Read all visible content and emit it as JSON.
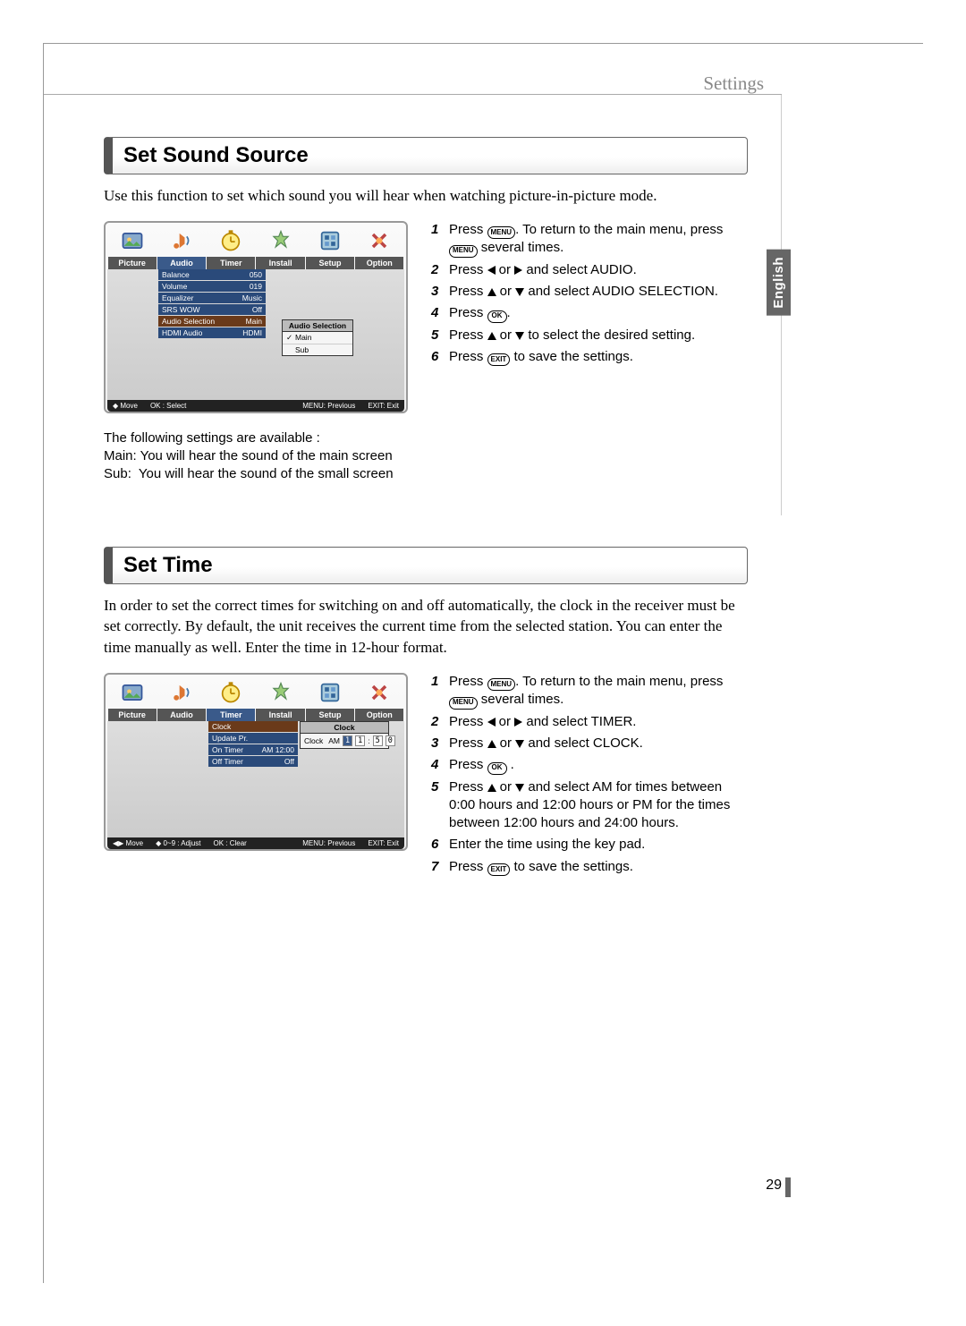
{
  "header": {
    "category": "Settings",
    "language": "English",
    "page_number": "29"
  },
  "tabs": [
    "Picture",
    "Audio",
    "Timer",
    "Install",
    "Setup",
    "Option"
  ],
  "section1": {
    "title": "Set Sound Source",
    "intro": "Use this function to set which sound you will hear when watching picture-in-picture mode.",
    "audio_menu": {
      "items": [
        {
          "label": "Balance",
          "value": "050"
        },
        {
          "label": "Volume",
          "value": "019"
        },
        {
          "label": "Equalizer",
          "value": "Music"
        },
        {
          "label": "SRS WOW",
          "value": "Off"
        },
        {
          "label": "Audio Selection",
          "value": "Main"
        },
        {
          "label": "HDMI Audio",
          "value": "HDMI"
        }
      ],
      "popup_title": "Audio Selection",
      "popup_options": [
        "Main",
        "Sub"
      ],
      "footer": {
        "move": "Move",
        "ok": "OK : Select",
        "menu": "MENU: Previous",
        "exit": "EXIT: Exit"
      }
    },
    "steps": {
      "s1a": "Press ",
      "s1b": ". To return to the main menu, press ",
      "s1c": " several times.",
      "s2a": "Press ",
      "s2b": " or ",
      "s2c": " and select AUDIO.",
      "s3a": "Press ",
      "s3b": " or ",
      "s3c": " and select AUDIO SELECTION.",
      "s4a": "Press ",
      "s4b": ".",
      "s5a": "Press ",
      "s5b": " or ",
      "s5c": " to select the desired setting.",
      "s6a": "Press ",
      "s6b": " to save the settings."
    },
    "available": {
      "heading": "The following settings are available :",
      "main": "Main: You will hear the sound of the main screen",
      "sub": "Sub:  You will hear the sound of the small screen"
    }
  },
  "section2": {
    "title": "Set Time",
    "intro": "In order to set the correct times for switching on and off automatically, the clock in the receiver must be set correctly. By default, the unit receives the current time from the selected station. You can enter the time manually as well. Enter the time in 12-hour format.",
    "timer_menu": {
      "items": [
        {
          "label": "Clock",
          "value": ""
        },
        {
          "label": "Update Pr.",
          "value": ""
        },
        {
          "label": "On Timer",
          "value": "AM 12:00"
        },
        {
          "label": "Off Timer",
          "value": "Off"
        }
      ],
      "popup_title": "Clock",
      "clock_label": "Clock",
      "ampm": "AM",
      "hh1": "1",
      "hh2": "1",
      "mm1": "5",
      "mm2": "0",
      "footer": {
        "move": "Move",
        "adjust": "0~9 : Adjust",
        "ok": "OK : Clear",
        "menu": "MENU: Previous",
        "exit": "EXIT: Exit"
      }
    },
    "steps": {
      "s1a": "Press ",
      "s1b": ". To return to the main menu, press ",
      "s1c": " several times.",
      "s2a": "Press ",
      "s2b": " or ",
      "s2c": " and select TIMER.",
      "s3a": "Press ",
      "s3b": " or ",
      "s3c": " and select CLOCK.",
      "s4a": "Press ",
      "s4b": " .",
      "s5a": "Press ",
      "s5b": " or ",
      "s5c": " and select AM for times between 0:00 hours and 12:00 hours or PM for the times between 12:00 hours and 24:00 hours.",
      "s6": "Enter the time using the key pad.",
      "s7a": "Press ",
      "s7b": " to save the settings."
    }
  },
  "buttons": {
    "menu": "MENU",
    "ok": "OK",
    "exit": "EXIT"
  }
}
